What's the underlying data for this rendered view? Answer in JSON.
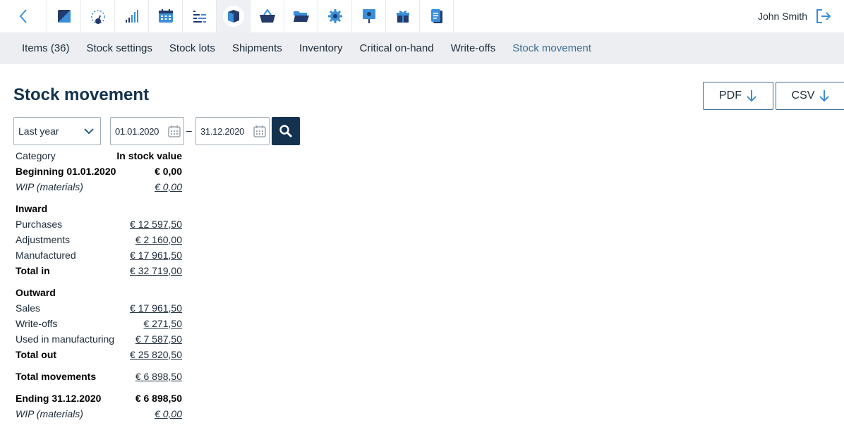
{
  "user": {
    "name": "John Smith"
  },
  "toolbar": {
    "icons": [
      "back-arrow",
      "stock-dark-square",
      "dashboard-gauge",
      "signal-bars",
      "calendar",
      "gantt-list",
      "stock-box",
      "shopping-basket",
      "folder-open",
      "gear",
      "presentation-board",
      "gift-box",
      "document"
    ],
    "active": "stock-box"
  },
  "subnav": [
    {
      "label": "Items (36)"
    },
    {
      "label": "Stock settings"
    },
    {
      "label": "Stock lots"
    },
    {
      "label": "Shipments"
    },
    {
      "label": "Inventory"
    },
    {
      "label": "Critical on-hand"
    },
    {
      "label": "Write-offs"
    },
    {
      "label": "Stock movement",
      "active": true
    }
  ],
  "page": {
    "title": "Stock movement"
  },
  "exports": {
    "pdf": "PDF",
    "csv": "CSV"
  },
  "filters": {
    "period": "Last year",
    "date_from": "01.01.2020",
    "date_separator": "–",
    "date_to": "31.12.2020"
  },
  "report": {
    "col_category": "Category",
    "col_value": "In stock value",
    "rows": [
      {
        "label": "Beginning 01.01.2020",
        "value": "€ 0,00"
      },
      {
        "label": "WIP (materials)",
        "value": "€ 0,00"
      },
      {
        "label": "Inward",
        "value": ""
      },
      {
        "label": "Purchases",
        "value": "€ 12 597,50"
      },
      {
        "label": "Adjustments",
        "value": "€ 2 160,00"
      },
      {
        "label": "Manufactured",
        "value": "€ 17 961,50"
      },
      {
        "label": "Total in",
        "value": "€ 32 719,00"
      },
      {
        "label": "Outward",
        "value": ""
      },
      {
        "label": "Sales",
        "value": "€ 17 961,50"
      },
      {
        "label": "Write-offs",
        "value": "€ 271,50"
      },
      {
        "label": "Used in manufacturing",
        "value": "€ 7 587,50"
      },
      {
        "label": "Total out",
        "value": "€ 25 820,50"
      },
      {
        "label": "Total movements",
        "value": "€ 6 898,50"
      },
      {
        "label": "Ending 31.12.2020",
        "value": "€ 6 898,50"
      },
      {
        "label": "WIP (materials)",
        "value": "€ 0,00"
      }
    ]
  },
  "colors": {
    "accent": "#3f6d92",
    "navy": "#12324f",
    "nav_bg": "#eceef1",
    "icon_blue": "#2d8fdc"
  }
}
